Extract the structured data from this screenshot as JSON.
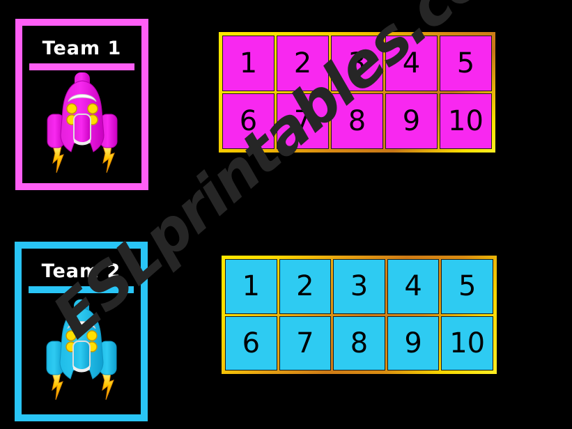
{
  "background_color": "#000000",
  "watermark": {
    "text": "ESLprintables.com",
    "color": "#262626"
  },
  "teams": [
    {
      "id": "team-1",
      "title": "Team 1",
      "accent_color": "#FF5FF5",
      "car_color": "#F828F0",
      "car_color_dark": "#D500CC",
      "grid": {
        "border_colors": [
          "#FFE800",
          "#C87818"
        ],
        "cell_color": "#F828F0",
        "text_color": "#000000",
        "rows": [
          [
            "1",
            "2",
            "3",
            "4",
            "5"
          ],
          [
            "6",
            "7",
            "8",
            "9",
            "10"
          ]
        ]
      }
    },
    {
      "id": "team-2",
      "title": "Team 2",
      "accent_color": "#29C5F6",
      "car_color": "#2ECBF2",
      "car_color_dark": "#13A8D6",
      "grid": {
        "border_colors": [
          "#FFE800",
          "#CE7C17"
        ],
        "cell_color": "#2ECBF2",
        "text_color": "#000000",
        "rows": [
          [
            "1",
            "2",
            "3",
            "4",
            "5"
          ],
          [
            "6",
            "7",
            "8",
            "9",
            "10"
          ]
        ]
      }
    }
  ]
}
